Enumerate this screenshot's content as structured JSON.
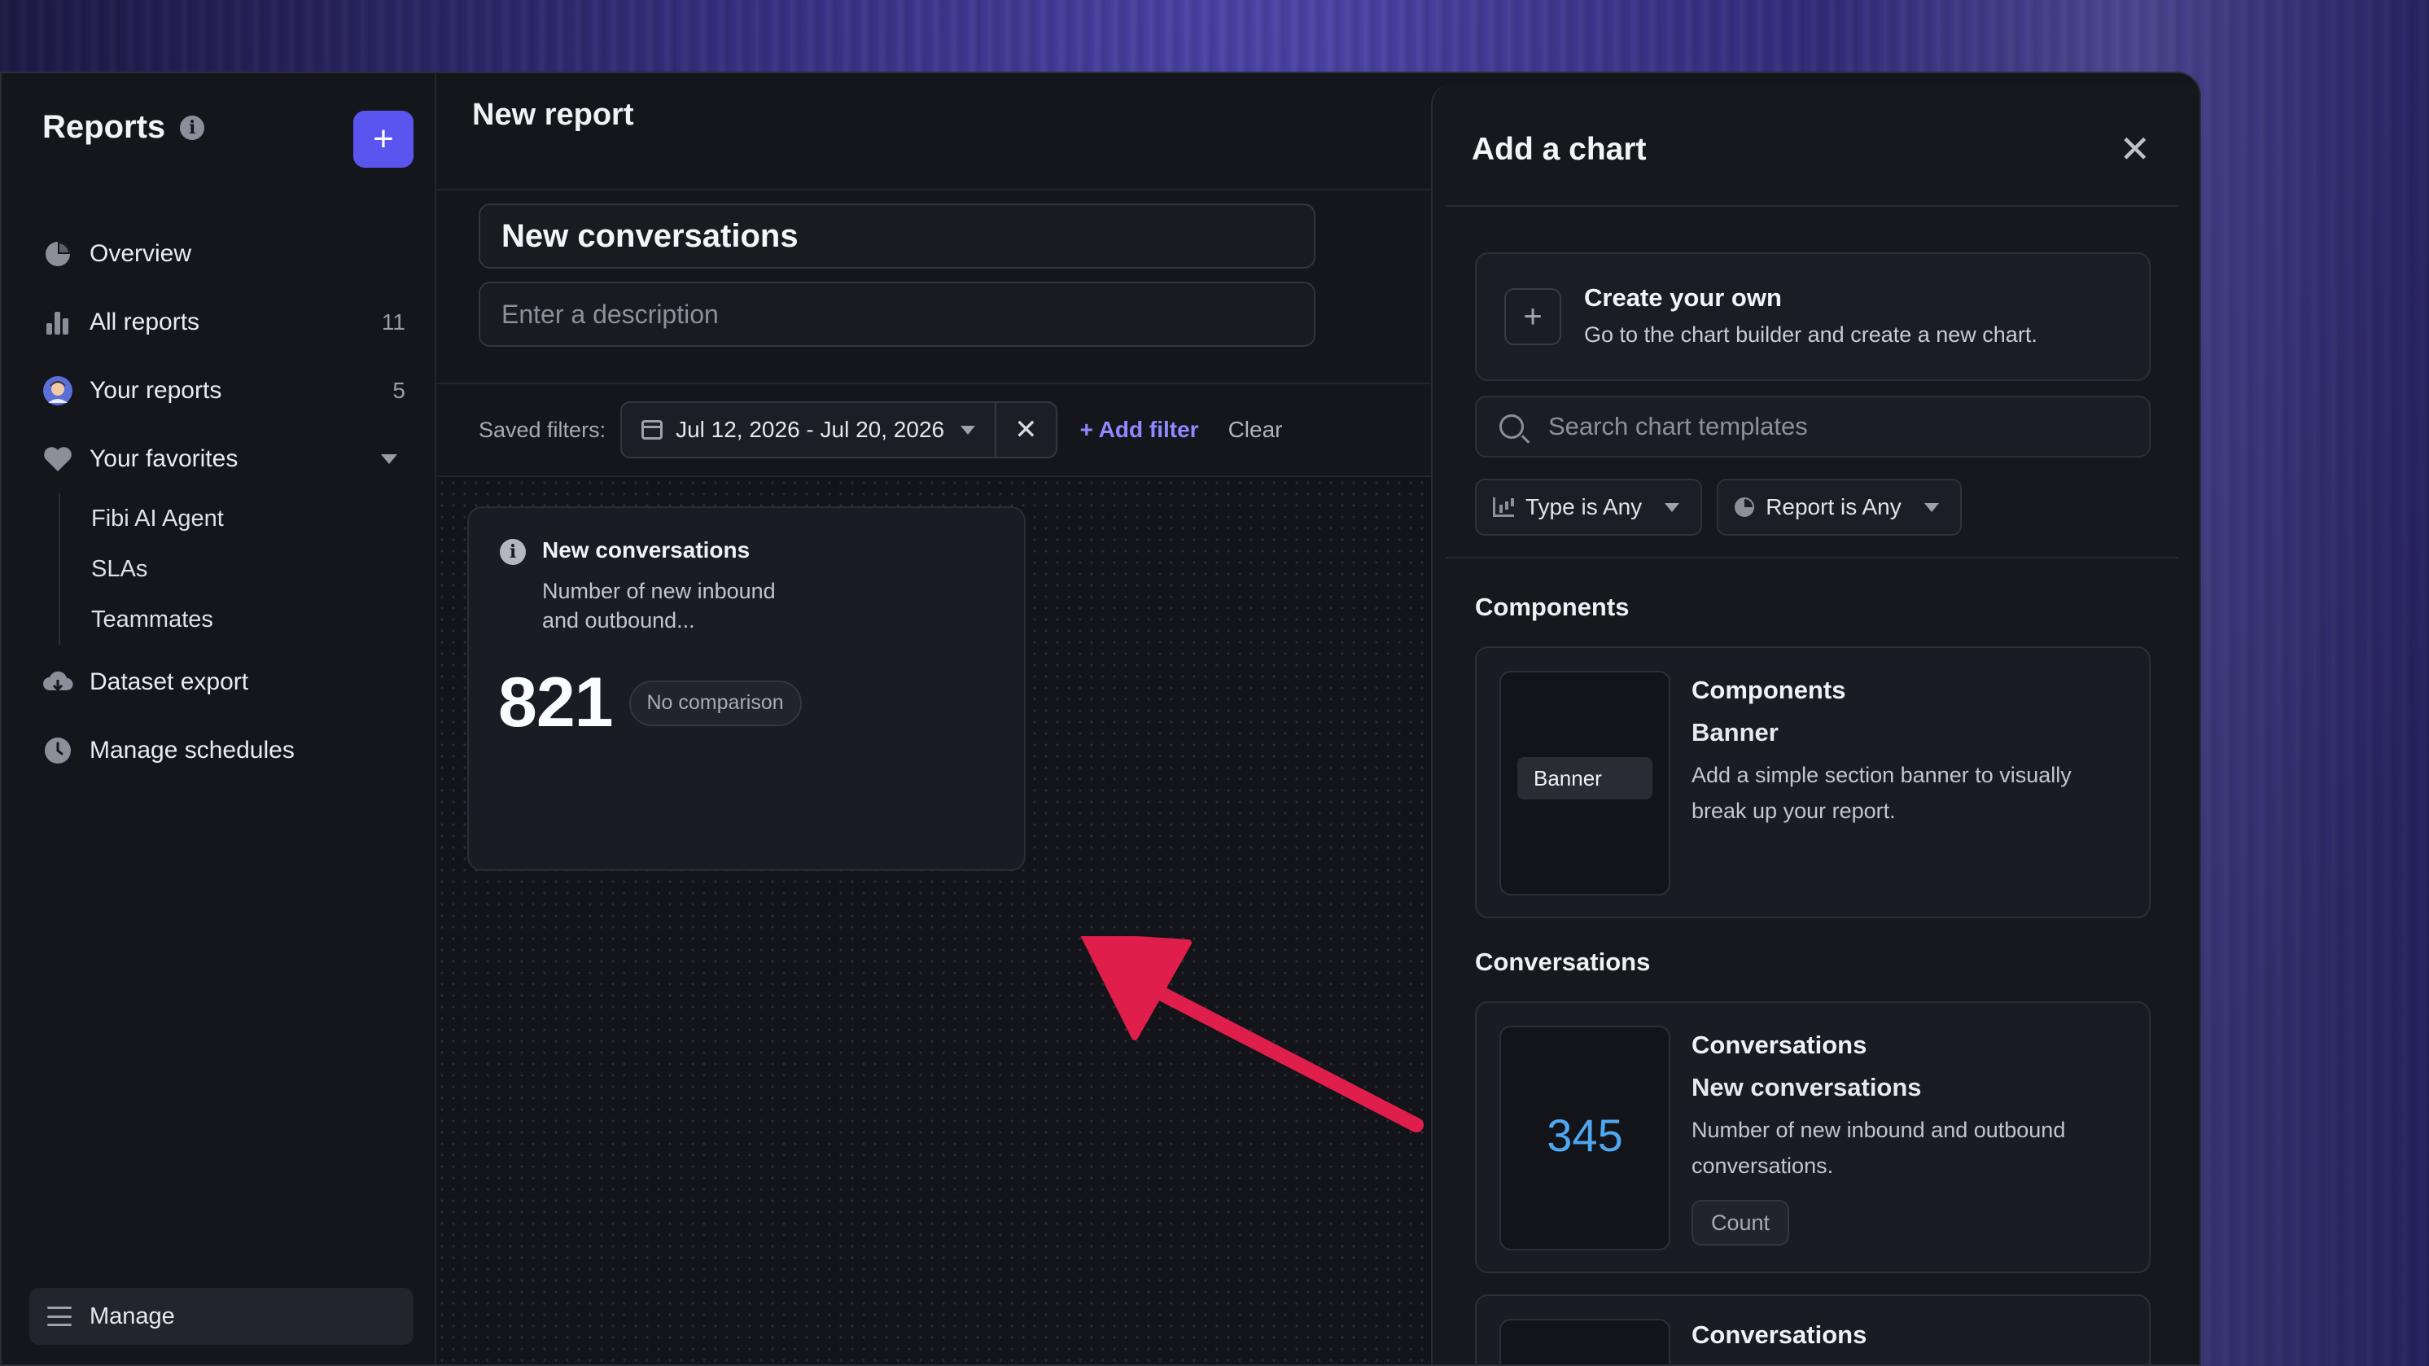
{
  "sidebar": {
    "title": "Reports",
    "new_button": "+",
    "nav": [
      {
        "label": "Overview",
        "icon": "pie-chart-icon",
        "count": ""
      },
      {
        "label": "All reports",
        "icon": "bar-chart-icon",
        "count": "11"
      },
      {
        "label": "Your reports",
        "icon": "avatar",
        "count": "5"
      },
      {
        "label": "Your favorites",
        "icon": "heart-icon",
        "count": ""
      }
    ],
    "favorites": [
      "Fibi AI Agent",
      "SLAs",
      "Teammates"
    ],
    "nav_bottom": [
      {
        "label": "Dataset export",
        "icon": "cloud-download-icon"
      },
      {
        "label": "Manage schedules",
        "icon": "clock-icon"
      }
    ],
    "manage_button": "Manage"
  },
  "main": {
    "title": "New report",
    "report_name": "New conversations",
    "description_placeholder": "Enter a description",
    "filters": {
      "label": "Saved filters:",
      "date_range": "Jul 12, 2026 - Jul 20, 2026",
      "remove": "✕",
      "add_filter": "+ Add filter",
      "clear": "Clear"
    },
    "card": {
      "info": "i",
      "title": "New conversations",
      "description": "Number of new inbound and outbound...",
      "value": "821",
      "badge": "No comparison"
    }
  },
  "panel": {
    "title": "Add a chart",
    "close": "✕",
    "create": {
      "plus": "+",
      "title": "Create your own",
      "subtitle": "Go to the chart builder and create a new chart."
    },
    "search_placeholder": "Search chart templates",
    "type_filter": "Type is Any",
    "report_filter": "Report is Any",
    "sections": [
      {
        "title": "Components",
        "template": {
          "category": "Components",
          "name": "Banner",
          "description": "Add a simple section banner to visually break up your report.",
          "thumb": "Banner"
        }
      },
      {
        "title": "Conversations",
        "template": {
          "category": "Conversations",
          "name": "New conversations",
          "description": "Number of new inbound and outbound conversations.",
          "thumb": "345",
          "badge": "Count"
        }
      }
    ],
    "next_category": "Conversations"
  },
  "colors": {
    "accent": "#5b55ef",
    "link": "#8f88ff",
    "arrow": "#e01e4b",
    "thumb_number": "#4fa7f0"
  }
}
